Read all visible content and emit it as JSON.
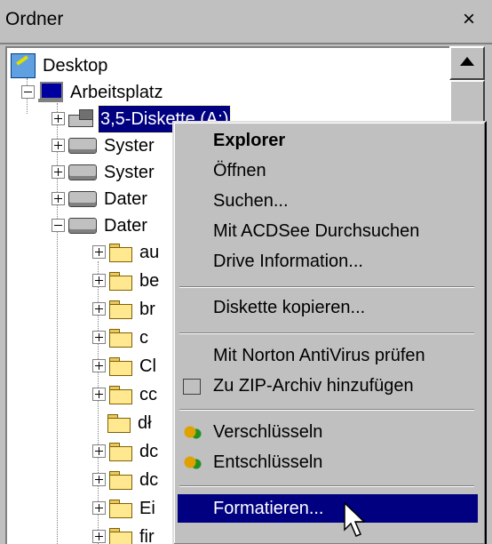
{
  "window": {
    "title": "Ordner",
    "close_glyph": "×"
  },
  "tree": {
    "desktop": "Desktop",
    "arbeitsplatz": "Arbeitsplatz",
    "diskette": "3,5-Diskette (A:)",
    "drives": [
      "Syster",
      "Syster",
      "Dater",
      "Dater"
    ],
    "folders": [
      "au",
      "be",
      "br",
      "c",
      "Cl",
      "cc",
      "dł",
      "dc",
      "dc",
      "Ei",
      "fir"
    ]
  },
  "context_menu": {
    "items": [
      {
        "label": "Explorer",
        "bold": true
      },
      {
        "label": "Öffnen"
      },
      {
        "label": "Suchen..."
      },
      {
        "label": "Mit ACDSee Durchsuchen"
      },
      {
        "label": "Drive Information..."
      },
      {
        "label": "Diskette kopieren..."
      },
      {
        "label": "Mit Norton AntiVirus prüfen"
      },
      {
        "label": "Zu ZIP-Archiv hinzufügen",
        "icon": "zip-icon"
      },
      {
        "label": "Verschlüsseln",
        "icon": "encrypt-icon"
      },
      {
        "label": "Entschlüsseln",
        "icon": "decrypt-icon"
      },
      {
        "label": "Formatieren...",
        "highlighted": true
      }
    ]
  },
  "colors": {
    "selection": "#000080",
    "face": "#c0c0c0"
  }
}
